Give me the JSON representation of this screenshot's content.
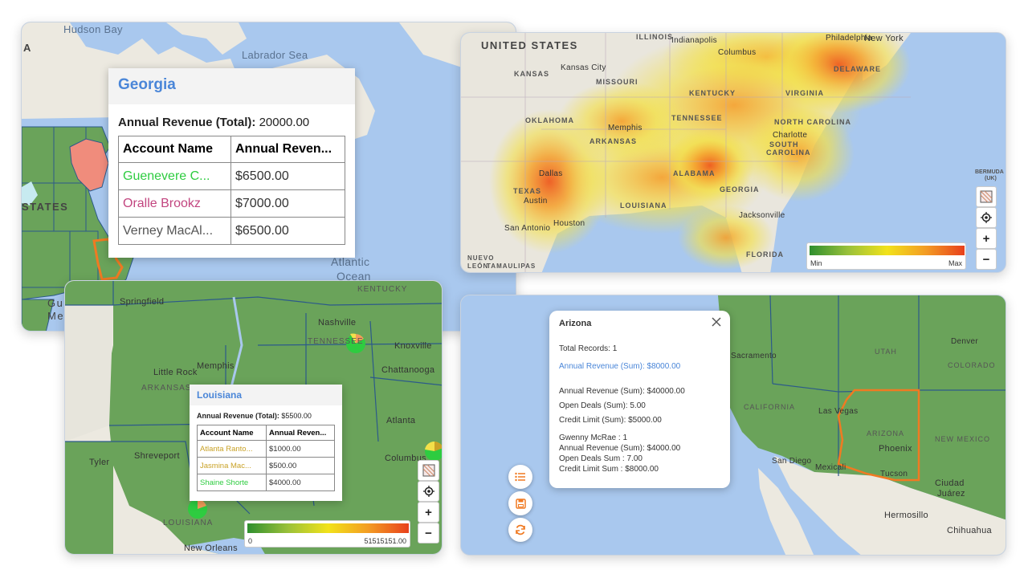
{
  "panel_georgia": {
    "map_labels": {
      "hudson_bay": "Hudson Bay",
      "labrador_sea": "Labrador Sea",
      "atlantic": "Atlantic",
      "ocean": "Ocean",
      "states": "STATES",
      "a_cut": "A",
      "gu": "Gu",
      "me": "Me"
    },
    "popup": {
      "title": "Georgia",
      "total_label": "Annual Revenue (Total):",
      "total_value": "20000.00",
      "headers": [
        "Account Name",
        "Annual Reven..."
      ],
      "rows": [
        {
          "name": "Guenevere C...",
          "value": "$6500.00",
          "color": "#2ecc40"
        },
        {
          "name": "Oralle Brookz",
          "value": "$7000.00",
          "color": "#c2457f"
        },
        {
          "name": "Verney MacAl...",
          "value": "$6500.00",
          "color": "#555555"
        }
      ]
    }
  },
  "panel_heatmap": {
    "map_labels": {
      "united_states": "UNITED STATES",
      "indianapolis": "Indianapolis",
      "philadelphia": "Philadelphia",
      "new_york": "New York",
      "illinois": "ILLINOIS",
      "columbus": "Columbus",
      "kansas": "KANSAS",
      "kansas_city": "Kansas City",
      "missouri": "MISSOURI",
      "delaware": "DELAWARE",
      "kentucky": "KENTUCKY",
      "virginia": "VIRGINIA",
      "oklahoma": "OKLAHOMA",
      "memphis": "Memphis",
      "tennessee": "TENNESSEE",
      "north_carolina": "NORTH CAROLINA",
      "charlotte": "Charlotte",
      "arkansas": "ARKANSAS",
      "south": "SOUTH",
      "carolina": "CAROLINA",
      "dallas": "Dallas",
      "texas": "TEXAS",
      "austin": "Austin",
      "alabama": "ALABAMA",
      "georgia": "GEORGIA",
      "louisiana": "LOUISIANA",
      "houston": "Houston",
      "san_antonio": "San Antonio",
      "jacksonville": "Jacksonville",
      "florida": "FLORIDA",
      "bermuda": "BERMUDA",
      "bermuda_uk": "(UK)",
      "nuevo": "NUEVO",
      "leon": "LEÓN",
      "tamaulipas": "TAMAULIPAS"
    },
    "legend": {
      "min": "Min",
      "max": "Max"
    }
  },
  "panel_louisiana": {
    "map_labels": {
      "kentucky": "KENTUCKY",
      "springfield": "Springfield",
      "nashville": "Nashville",
      "tennessee": "TENNESSEE",
      "knoxville": "Knoxville",
      "memphis": "Memphis",
      "little_rock": "Little Rock",
      "chattanooga": "Chattanooga",
      "arkansas": "ARKANSAS",
      "atlanta": "Atlanta",
      "tyler": "Tyler",
      "shreveport": "Shreveport",
      "columbus": "Columbus",
      "louisiana": "LOUISIANA",
      "new_orleans": "New Orleans"
    },
    "popup": {
      "title": "Louisiana",
      "total_label": "Annual Revenue (Total):",
      "total_value": "$5500.00",
      "headers": [
        "Account Name",
        "Annual Reven..."
      ],
      "rows": [
        {
          "name": "Atlanta Ranto...",
          "value": "$1000.00",
          "color": "#c9a227"
        },
        {
          "name": "Jasmina Mac...",
          "value": "$500.00",
          "color": "#c9a227"
        },
        {
          "name": "Shaine Shorte",
          "value": "$4000.00",
          "color": "#2ecc40"
        }
      ]
    },
    "legend": {
      "min": "0",
      "max": "51515151.00"
    }
  },
  "panel_arizona": {
    "map_labels": {
      "utah": "UTAH",
      "sacramento": "Sacramento",
      "colorado": "COLORADO",
      "denver": "Denver",
      "california": "CALIFORNIA",
      "las_vegas": "Las Vegas",
      "arizona": "ARIZONA",
      "phoenix": "Phoenix",
      "new_mexico": "NEW MEXICO",
      "san_diego": "San Diego",
      "mexicali": "Mexicali",
      "tucson": "Tucson",
      "ciudad": "Ciudad",
      "juarez": "Juárez",
      "hermosillo": "Hermosillo",
      "chihuahua": "Chihuahua"
    },
    "popup": {
      "title": "Arizona",
      "total_records": "Total Records: 1",
      "highlight": "Annual Revenue (Sum): $8000.00",
      "lines_a": [
        "Annual Revenue (Sum): $40000.00",
        "Open Deals (Sum): 5.00",
        "Credit Limit (Sum): $5000.00"
      ],
      "lines_b": [
        "Gwenny McRae : 1",
        "Annual Revenue (Sum): $4000.00",
        "Open Deals Sum : 7.00",
        "Credit Limit Sum : $8000.00"
      ]
    }
  },
  "controls": {
    "plus": "+",
    "minus": "−"
  },
  "icons": [
    "map-layers-icon",
    "locate-icon",
    "list-icon",
    "save-icon",
    "refresh-icon",
    "close-icon"
  ]
}
